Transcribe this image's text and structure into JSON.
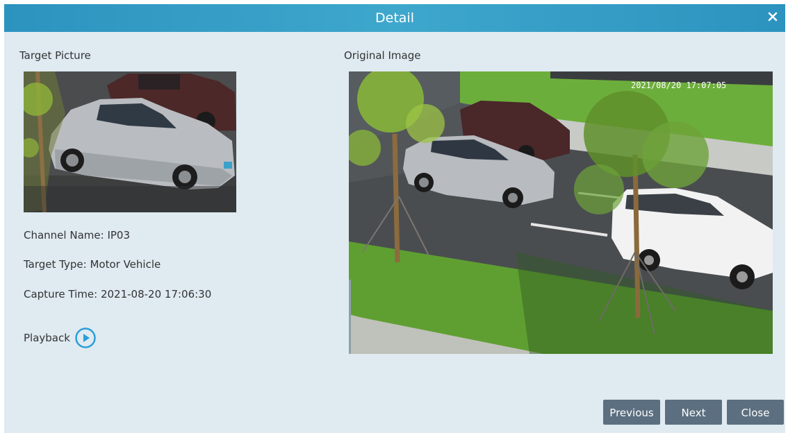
{
  "dialog": {
    "title": "Detail",
    "close_icon": "close-icon"
  },
  "target_section": {
    "label": "Target Picture"
  },
  "original_section": {
    "label": "Original Image",
    "timestamp_overlay": "2021/08/20 17:07:05"
  },
  "info": {
    "channel_label": "Channel Name:",
    "channel_value": "IP03",
    "type_label": "Target Type:",
    "type_value": "Motor Vehicle",
    "time_label": "Capture Time:",
    "time_value": "2021-08-20 17:06:30"
  },
  "playback": {
    "label": "Playback",
    "icon": "play-circle-icon",
    "accent": "#2a9fd8"
  },
  "buttons": {
    "previous": "Previous",
    "next": "Next",
    "close": "Close"
  },
  "colors": {
    "title_bar": "#3aa0c9",
    "dialog_bg": "#dfeaf1",
    "button_bg": "#5b6f80"
  }
}
